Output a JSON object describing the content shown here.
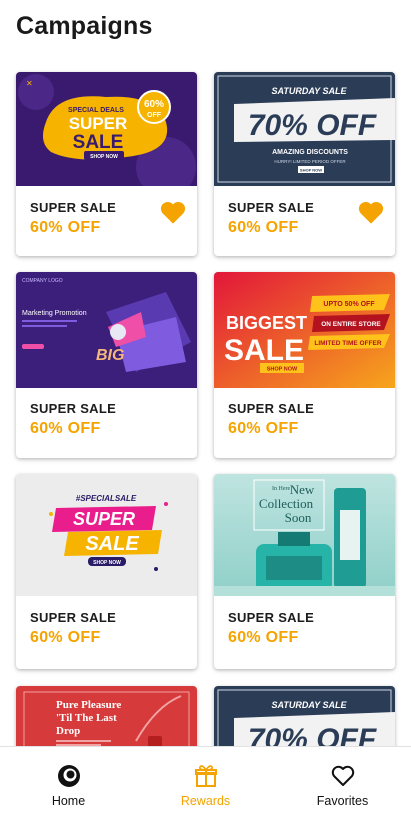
{
  "page": {
    "title": "Campaigns"
  },
  "campaigns": [
    {
      "name": "SUPER SALE",
      "discount": "60% OFF",
      "favorite": true,
      "banner": {
        "l1": "SPECIAL DEALS",
        "l2": "SUPER",
        "l3": "SALE",
        "badge": "60%",
        "badge2": "OFF",
        "btn": "SHOP NOW"
      }
    },
    {
      "name": "SUPER SALE",
      "discount": "60% OFF",
      "favorite": true,
      "banner": {
        "l1": "SATURDAY SALE",
        "l2": "70% OFF",
        "l3": "AMAZING DISCOUNTS",
        "l4": "HURRY! LIMITED PERIOD OFFER",
        "btn": "SHOP NOW"
      }
    },
    {
      "name": "SUPER SALE",
      "discount": "60% OFF",
      "favorite": false,
      "banner": {
        "l1": "COMPANY LOGO",
        "l2": "Marketing Promotion",
        "l3": "BIG"
      }
    },
    {
      "name": "SUPER SALE",
      "discount": "60% OFF",
      "favorite": false,
      "banner": {
        "l1": "BIGGEST",
        "l2": "SALE",
        "l3": "UPTO 50% OFF",
        "l4": "ON ENTIRE STORE",
        "l5": "LIMITED TIME OFFER",
        "btn": "SHOP NOW"
      }
    },
    {
      "name": "SUPER SALE",
      "discount": "60% OFF",
      "favorite": false,
      "banner": {
        "l1": "#SPECIALSALE",
        "l2": "SUPER",
        "l3": "SALE",
        "btn": "SHOP NOW"
      }
    },
    {
      "name": "SUPER SALE",
      "discount": "60% OFF",
      "favorite": false,
      "banner": {
        "l1": "In Here",
        "l2": "New",
        "l3": "Collection",
        "l4": "Soon"
      }
    },
    {
      "name": "",
      "discount": "",
      "favorite": false,
      "banner": {
        "l1": "Pure Pleasure",
        "l2": "'Til The Last",
        "l3": "Drop"
      }
    },
    {
      "name": "",
      "discount": "",
      "favorite": false,
      "banner": {
        "l1": "SATURDAY SALE",
        "l2": "70% OFF"
      }
    }
  ],
  "nav": {
    "items": [
      {
        "label": "Home",
        "icon": "home-ring-icon"
      },
      {
        "label": "Rewards",
        "icon": "gift-icon",
        "active": true
      },
      {
        "label": "Favorites",
        "icon": "heart-outline-icon"
      }
    ]
  },
  "colors": {
    "accent": "#f5a300",
    "heart": "#f5a300",
    "text": "#1d1d1d"
  }
}
